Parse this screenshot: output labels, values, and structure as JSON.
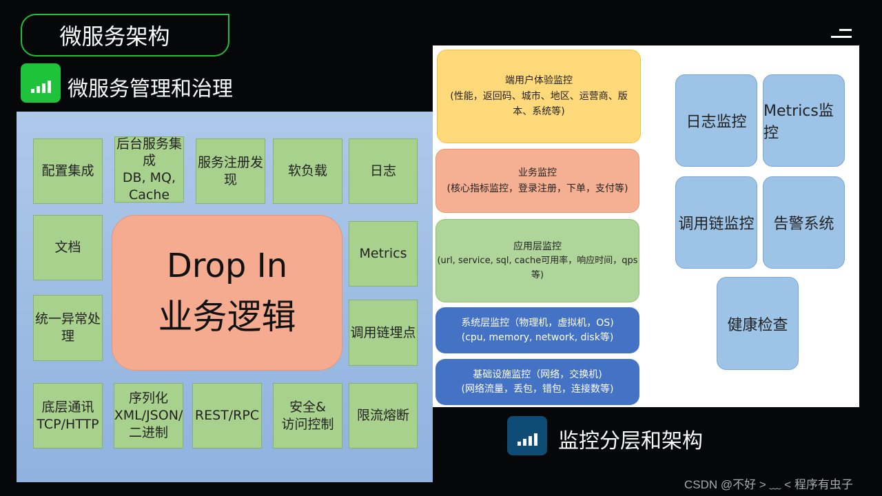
{
  "header": {
    "title": "微服务架构",
    "section1": "微服务管理和治理",
    "section2": "监控分层和架构"
  },
  "left": {
    "boxes": [
      "配置集成",
      "后台服务集成\nDB, MQ,\nCache",
      "服务注册发现",
      "软负载",
      "日志",
      "文档",
      "Metrics",
      "统一异常处理",
      "调用链埋点",
      "底层通讯\nTCP/HTTP",
      "序列化\nXML/JSON/\n二进制",
      "REST/RPC",
      "安全&\n访问控制",
      "限流熔断"
    ],
    "center": {
      "line1": "Drop In",
      "line2": "业务逻辑"
    }
  },
  "right": {
    "layers": [
      {
        "title": "端用户体验监控",
        "desc": "(性能，返回码、城市、地区、运营商、版本、系统等)",
        "color": "#ffd97a"
      },
      {
        "title": "业务监控",
        "desc": "(核心指标监控，登录注册，下单，支付等)",
        "color": "#f5b094"
      },
      {
        "title": "应用层监控",
        "desc": "(url, service, sql, cache可用率，响应时间，qps等)",
        "color": "#b0d59a"
      },
      {
        "title": "系统层监控（物理机，虚拟机，OS)",
        "desc": "(cpu, memory, network, disk等)",
        "color": "#4472c4"
      },
      {
        "title": "基础设施监控（网络，交换机)",
        "desc": "(网络流量，丢包，错包，连接数等)",
        "color": "#4472c4"
      }
    ],
    "boxes": [
      "日志监控",
      "Metrics监控",
      "调用链监控",
      "告警系统",
      "健康检查"
    ]
  },
  "footer": {
    "watermark": "CSDN @不好 > ﹏ < 程序有虫子"
  },
  "colors": {
    "accent_green": "#22c03a",
    "icon_blue": "#0f4c75"
  }
}
